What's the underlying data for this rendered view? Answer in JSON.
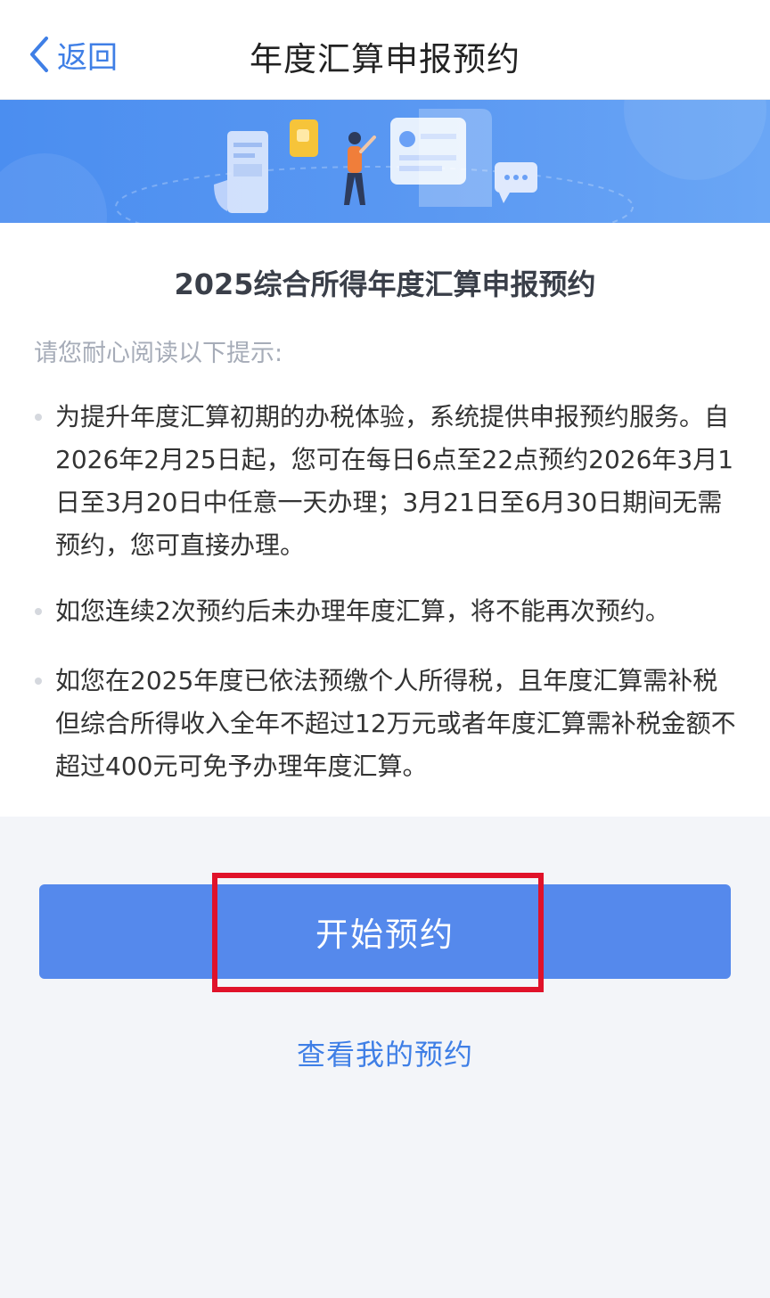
{
  "nav": {
    "back_label": "返回",
    "title": "年度汇算申报预约"
  },
  "card": {
    "title": "2025综合所得年度汇算申报预约",
    "intro": "请您耐心阅读以下提示:",
    "notices": [
      "为提升年度汇算初期的办税体验，系统提供申报预约服务。自2026年2月25日起，您可在每日6点至22点预约2026年3月1日至3月20日中任意一天办理；3月21日至6月30日期间无需预约，您可直接办理。",
      "如您连续2次预约后未办理年度汇算，将不能再次预约。",
      "如您在2025年度已依法预缴个人所得税，且年度汇算需补税但综合所得收入全年不超过12万元或者年度汇算需补税金额不超过400元可免予办理年度汇算。"
    ]
  },
  "actions": {
    "start_label": "开始预约",
    "view_label": "查看我的预约"
  },
  "colors": {
    "accent": "#3f7fe6",
    "button": "#5589ec",
    "highlight": "#e0122a"
  }
}
